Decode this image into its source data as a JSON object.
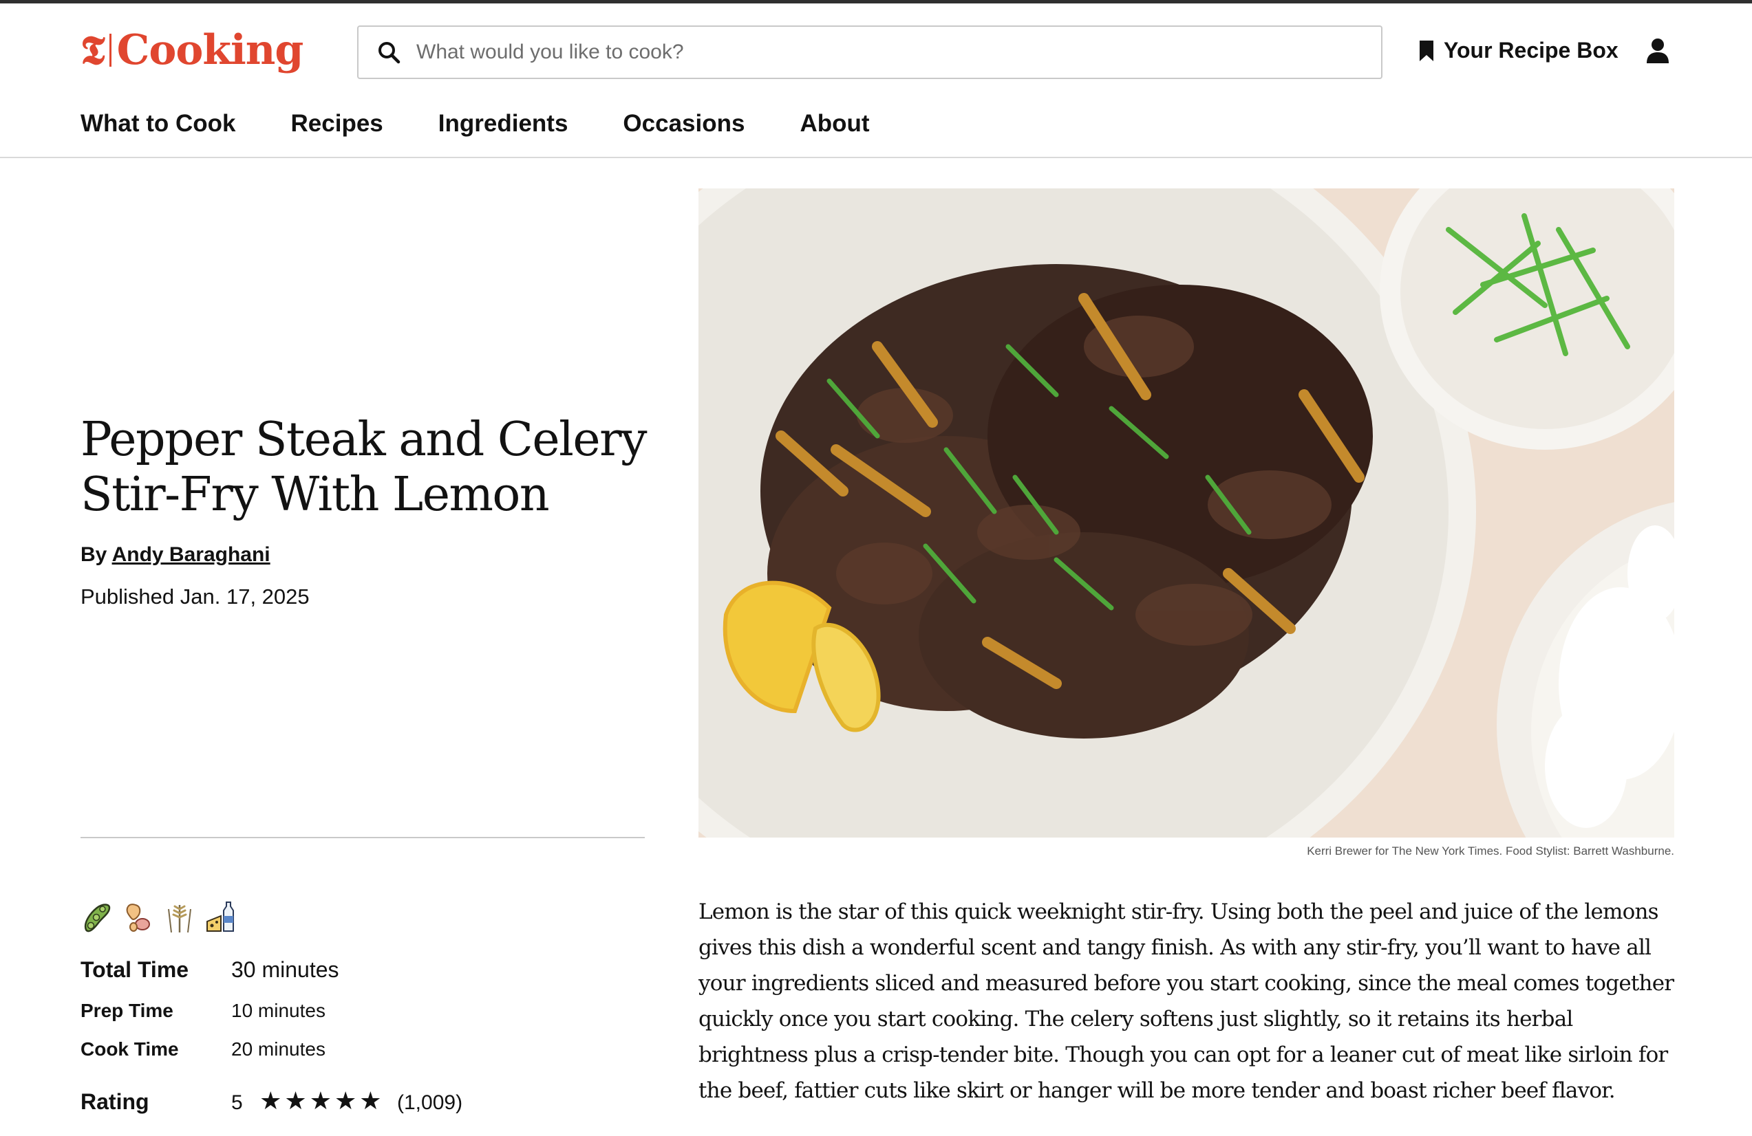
{
  "header": {
    "logo_word": "Cooking",
    "search_placeholder": "What would you like to cook?",
    "recipe_box_label": "Your Recipe Box"
  },
  "nav": {
    "items": [
      {
        "label": "What to Cook"
      },
      {
        "label": "Recipes"
      },
      {
        "label": "Ingredients"
      },
      {
        "label": "Occasions"
      },
      {
        "label": "About"
      }
    ]
  },
  "recipe": {
    "title": "Pepper Steak and Celery Stir-Fry With Lemon",
    "by_prefix": "By",
    "author": "Andy Baraghani",
    "published": "Published Jan. 17, 2025",
    "photo_credit": "Kerri Brewer for The New York Times. Food Stylist: Barrett Washburne.",
    "description": "Lemon is the star of this quick weeknight stir-fry. Using both the peel and juice of the lemons gives this dish a wonderful scent and tangy finish. As with any stir-fry, you’ll want to have all your ingredients sliced and measured before you start cooking, since the meal comes together quickly once you start cooking. The celery softens just slightly, so it retains its herbal brightness plus a crisp-tender bite. Though you can opt for a leaner cut of meat like sirloin for the beef, fattier cuts like skirt or hanger will be more tender and boast richer beef flavor."
  },
  "meta": {
    "total_time_label": "Total Time",
    "total_time_value": "30 minutes",
    "prep_time_label": "Prep Time",
    "prep_time_value": "10 minutes",
    "cook_time_label": "Cook Time",
    "cook_time_value": "20 minutes",
    "rating_label": "Rating",
    "rating_value": "5",
    "rating_count": "(1,009)",
    "stars_filled": 5,
    "stars_total": 5
  },
  "diet_icons": [
    "soy-free-icon",
    "nut-free-icon",
    "gluten-free-icon",
    "dairy-free-icon"
  ],
  "colors": {
    "brand_red": "#e0462f",
    "text": "#121212",
    "divider": "#c9c9c9"
  }
}
